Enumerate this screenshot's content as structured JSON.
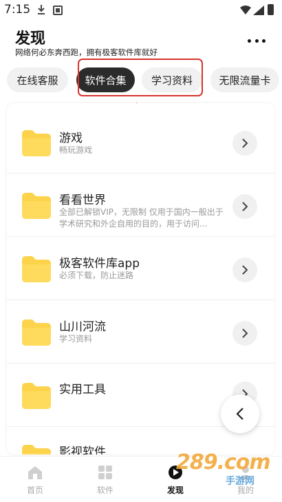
{
  "status_bar": {
    "time": "7:15",
    "icons": [
      "download-icon",
      "app-icon",
      "wifi-icon",
      "signal-icon",
      "battery-icon"
    ]
  },
  "header": {
    "title": "发现",
    "subtitle": "网络何必东奔西跑，拥有极客软件库就好",
    "more_icon": "more-icon"
  },
  "tabs": [
    {
      "label": "在线客服",
      "active": false
    },
    {
      "label": "软件合集",
      "active": true
    },
    {
      "label": "学习资料",
      "active": false
    },
    {
      "label": "无限流量卡",
      "active": false
    }
  ],
  "annotation": {
    "highlight_color": "#d6332d"
  },
  "list": [
    {
      "title": "游戏",
      "desc": "畅玩游戏"
    },
    {
      "title": "看看世界",
      "desc": "全部已解锁VIP，无限制 仅用于国内一般出于学术研究和外企自用的目的，用于访问..."
    },
    {
      "title": "极客软件库app",
      "desc": "必须下载，防止迷路"
    },
    {
      "title": "山川河流",
      "desc": "学习资料"
    },
    {
      "title": "实用工具",
      "desc": ""
    },
    {
      "title": "影视软件",
      "desc": ""
    }
  ],
  "bottom_nav": [
    {
      "label": "首页",
      "icon": "home-icon",
      "active": false
    },
    {
      "label": "软件",
      "icon": "grid-icon",
      "active": false
    },
    {
      "label": "发现",
      "icon": "discover-icon",
      "active": true
    },
    {
      "label": "我的",
      "icon": "profile-icon",
      "active": false
    }
  ],
  "watermark": {
    "logo": "289.com",
    "text": "手游网"
  },
  "colors": {
    "folder": "#fdd34b",
    "active_tab": "#2b2b2b",
    "accent_red": "#d6332d"
  }
}
